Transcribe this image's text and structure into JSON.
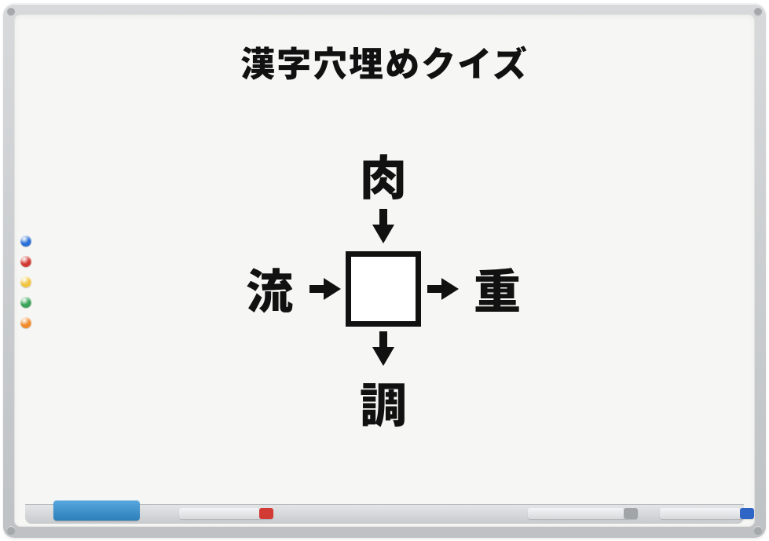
{
  "title": "漢字穴埋めクイズ",
  "puzzle": {
    "top": "肉",
    "left": "流",
    "right": "重",
    "bottom": "調",
    "center": ""
  },
  "magnets": [
    "#2a6fd6",
    "#d23a34",
    "#f1c441",
    "#39a357",
    "#ef8b2b"
  ]
}
